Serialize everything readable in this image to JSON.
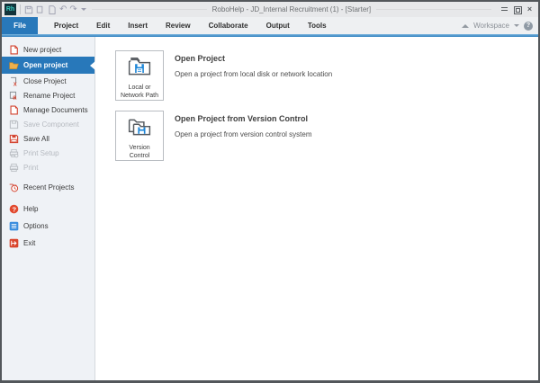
{
  "window": {
    "title": "RoboHelp - JD_Internal Recruitment (1) - [Starter]"
  },
  "titlebar": {
    "app_logo_text": "Rh",
    "close_glyph": "×"
  },
  "menubar": {
    "file_tab": "File",
    "items": [
      "Project",
      "Edit",
      "Insert",
      "Review",
      "Collaborate",
      "Output",
      "Tools"
    ],
    "workspace_label": "Workspace",
    "help_glyph": "?"
  },
  "sidebar": {
    "items": [
      {
        "label": "New project",
        "icon": "new-project-icon",
        "enabled": true,
        "selected": false
      },
      {
        "label": "Open project",
        "icon": "open-project-icon",
        "enabled": true,
        "selected": true
      },
      {
        "label": "Close Project",
        "icon": "close-project-icon",
        "enabled": true,
        "selected": false
      },
      {
        "label": "Rename Project",
        "icon": "rename-project-icon",
        "enabled": true,
        "selected": false
      },
      {
        "label": "Manage Documents",
        "icon": "manage-documents-icon",
        "enabled": true,
        "selected": false
      },
      {
        "label": "Save Component",
        "icon": "save-component-icon",
        "enabled": false,
        "selected": false
      },
      {
        "label": "Save All",
        "icon": "save-all-icon",
        "enabled": true,
        "selected": false
      },
      {
        "label": "Print Setup",
        "icon": "print-setup-icon",
        "enabled": false,
        "selected": false
      },
      {
        "label": "Print",
        "icon": "print-icon",
        "enabled": false,
        "selected": false
      },
      {
        "label": "Recent Projects",
        "icon": "recent-projects-icon",
        "enabled": true,
        "selected": false
      },
      {
        "label": "Help",
        "icon": "help-icon",
        "enabled": true,
        "selected": false
      },
      {
        "label": "Options",
        "icon": "options-icon",
        "enabled": true,
        "selected": false
      },
      {
        "label": "Exit",
        "icon": "exit-icon",
        "enabled": true,
        "selected": false
      }
    ]
  },
  "main": {
    "options": [
      {
        "icon": "local-network-folder-icon",
        "icon_label": "Local or Network Path",
        "title": "Open Project",
        "description": "Open a project from local disk or network location"
      },
      {
        "icon": "version-control-folder-icon",
        "icon_label": "Version Control",
        "title": "Open Project from Version Control",
        "description": "Open a project from version control system"
      }
    ]
  },
  "colors": {
    "accent_blue": "#2878ba",
    "selected_item_bg": "#2878ba",
    "disabled_text": "#b6bac0",
    "sidebar_bg": "#eff2f6",
    "titlebar_bg": "#e7e8ea"
  }
}
